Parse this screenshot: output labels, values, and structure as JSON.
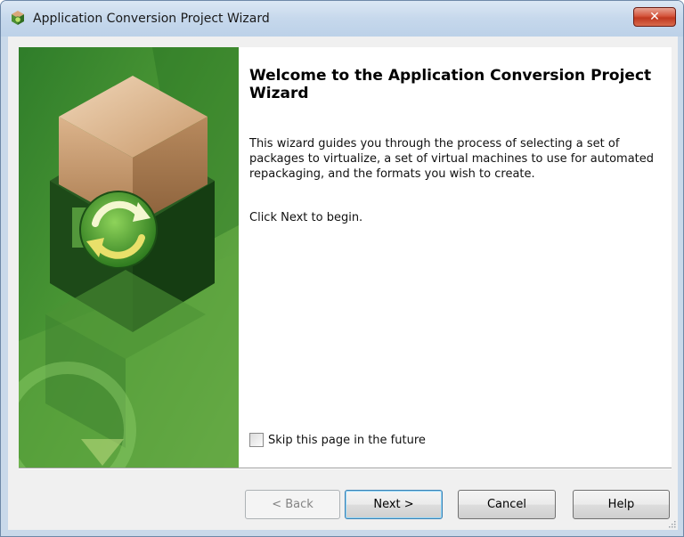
{
  "window": {
    "title": "Application Conversion Project Wizard",
    "close_symbol": "✕",
    "icon": "wizard-box-icon"
  },
  "page": {
    "heading": "Welcome to the Application Conversion Project Wizard",
    "description": "This wizard guides you through the process of selecting a set of packages to virtualize, a set of virtual machines to use for automated repackaging, and the formats you wish to create.",
    "hint": "Click Next to begin.",
    "skip_label": "Skip this page in the future",
    "skip_checked": false
  },
  "buttons": {
    "back": "< Back",
    "next": "Next >",
    "cancel": "Cancel",
    "help": "Help"
  },
  "colors": {
    "banner_green": "#3f8a2e",
    "accent_orange": "#c89a6a",
    "close_red": "#c8432a"
  }
}
